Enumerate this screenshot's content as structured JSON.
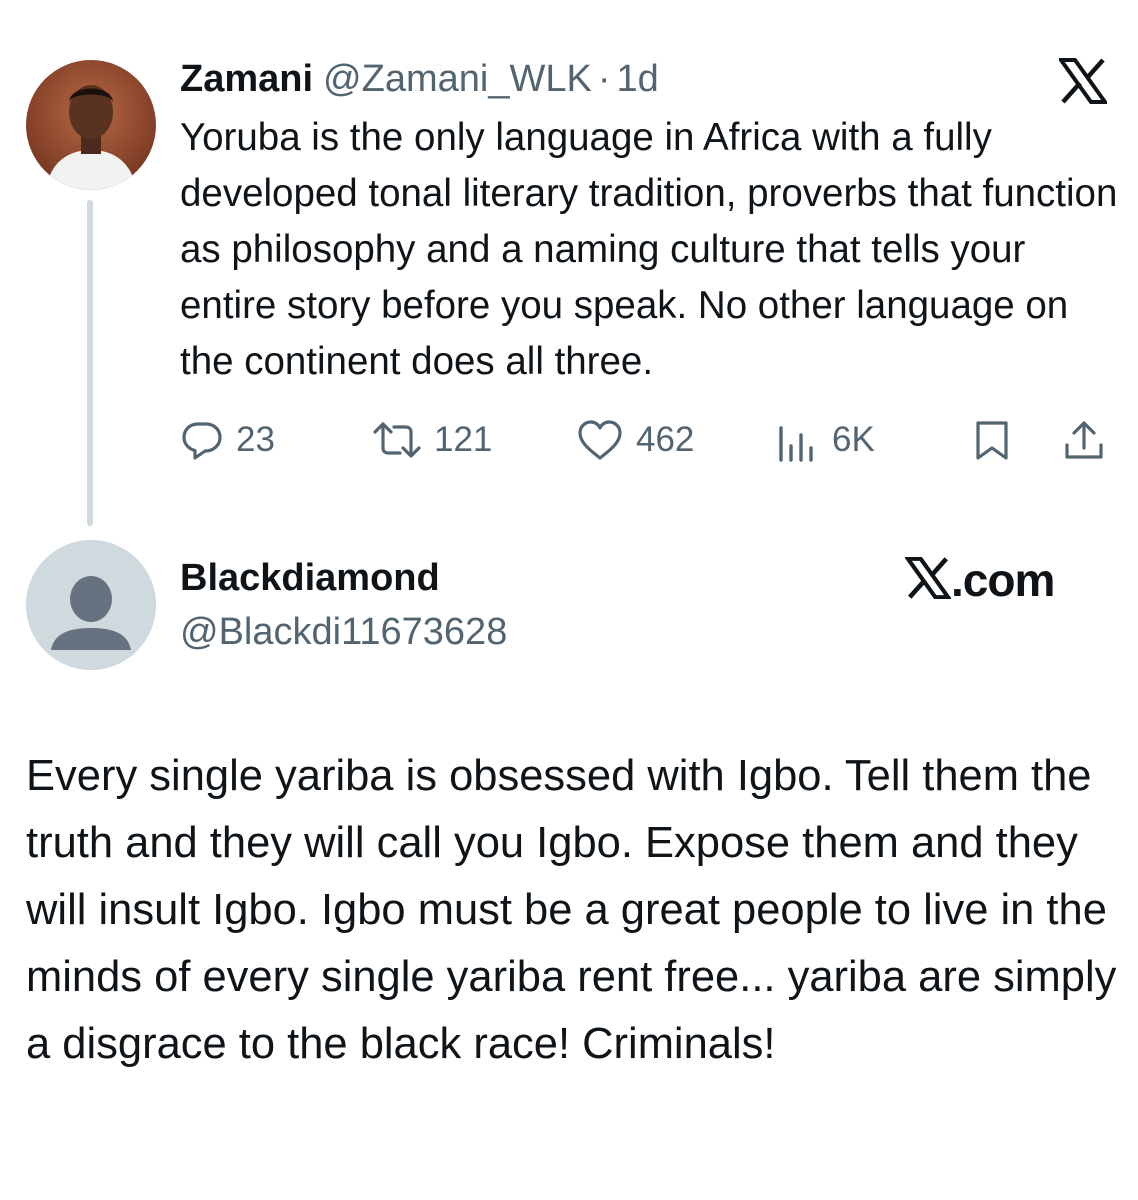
{
  "post": {
    "author_name": "Zamani",
    "handle": "@Zamani_WLK",
    "separator": "·",
    "time": "1d",
    "text": "Yoruba is the only language in Africa with a fully developed tonal literary tradition, proverbs that function as philosophy and a naming culture that tells your entire story before you speak. No other language on the continent does all three.",
    "logo_icon": "x-logo-icon",
    "stats": {
      "replies": "23",
      "reposts": "121",
      "likes": "462",
      "views": "6K"
    }
  },
  "reply": {
    "author_name": "Blackdiamond",
    "handle": "@Blackdi11673628",
    "site_label": ".com",
    "text": "Every single yariba is obsessed with Igbo. Tell them the truth and they will call you Igbo. Expose them and they will insult Igbo. Igbo must be a great people to live in the minds of every single yariba rent free... yariba are simply a disgrace to the black race! Criminals!"
  },
  "colors": {
    "text": "#0f1419",
    "secondary": "#536471",
    "thread_line": "#cfd9de",
    "default_avatar_bg": "#cfd9de",
    "default_avatar_fg": "#66727f"
  }
}
